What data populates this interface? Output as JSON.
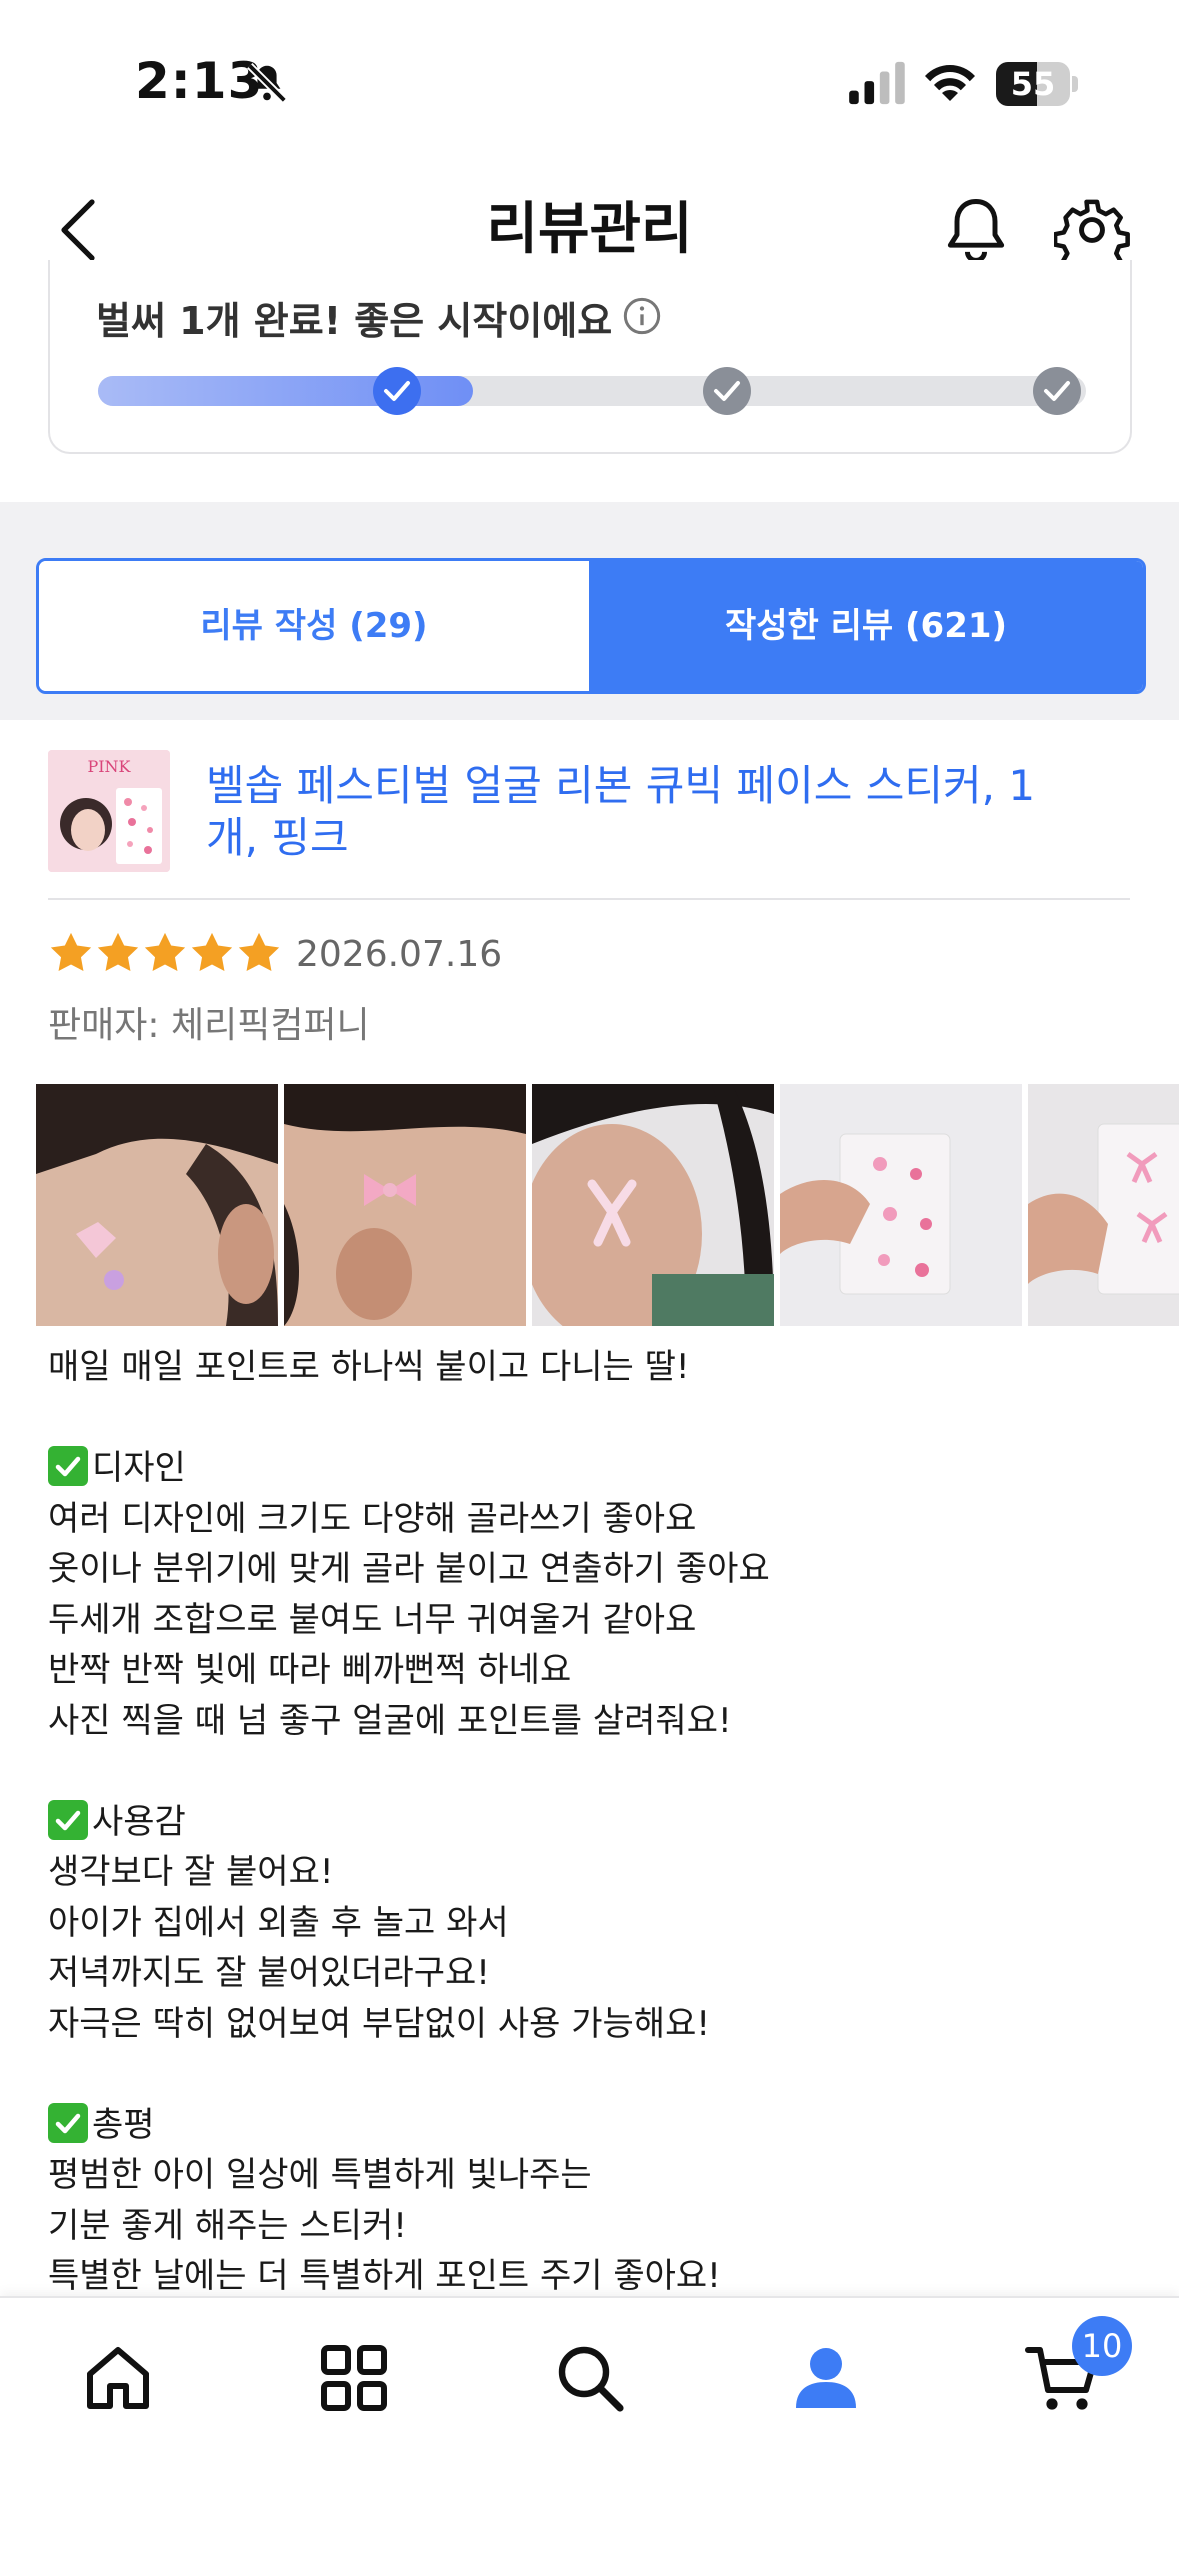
{
  "status_bar": {
    "time": "2:13",
    "battery": "55"
  },
  "header": {
    "title": "리뷰관리"
  },
  "progress": {
    "message": "벌써 1개 완료! 좋은 시작이에요",
    "completed_steps": 1,
    "total_steps": 3,
    "fill_fraction": 0.38,
    "accent_color": "#3d7cf5"
  },
  "tabs": [
    {
      "label": "리뷰 작성 (29)",
      "selected": false
    },
    {
      "label": "작성한 리뷰 (621)",
      "selected": true
    }
  ],
  "review": {
    "product_name": "벨솝 페스티벌 얼굴 리본 큐빅 페이스 스티커, 1개, 핑크",
    "product_thumb_text": "PINK",
    "rating": 5,
    "date": "2026.07.16",
    "seller_label": "판매자:",
    "seller_name": "체리픽컴퍼니",
    "photo_count_visible": 5,
    "lines": [
      {
        "text": "매일 매일 포인트로 하나씩 붙이고 다니는 딸!",
        "check": false
      },
      {
        "text": "",
        "check": false
      },
      {
        "text": "디자인",
        "check": true
      },
      {
        "text": "여러 디자인에 크기도 다양해 골라쓰기 좋아요",
        "check": false
      },
      {
        "text": "옷이나 분위기에 맞게 골라 붙이고 연출하기 좋아요",
        "check": false
      },
      {
        "text": "두세개 조합으로 붙여도 너무 귀여울거 같아요",
        "check": false
      },
      {
        "text": "반짝 반짝 빛에 따라 삐까뻔쩍 하네요",
        "check": false
      },
      {
        "text": "사진 찍을 때 넘 좋구 얼굴에 포인트를 살려줘요!",
        "check": false
      },
      {
        "text": "",
        "check": false
      },
      {
        "text": "사용감",
        "check": true
      },
      {
        "text": "생각보다 잘 붙어요!",
        "check": false
      },
      {
        "text": "아이가 집에서 외출 후 놀고 와서",
        "check": false
      },
      {
        "text": "저녁까지도 잘 붙어있더라구요!",
        "check": false
      },
      {
        "text": "자극은 딱히 없어보여 부담없이 사용 가능해요!",
        "check": false
      },
      {
        "text": "",
        "check": false
      },
      {
        "text": "총평",
        "check": true
      },
      {
        "text": "평범한 아이 일상에 특별하게 빛나주는",
        "check": false
      },
      {
        "text": "기분 좋게 해주는 스티커!",
        "check": false
      },
      {
        "text": "특별한 날에는 더 특별하게 포인트 주기 좋아요!",
        "check": false
      }
    ]
  },
  "bottom_nav": {
    "items": [
      {
        "icon": "home-icon"
      },
      {
        "icon": "grid-icon"
      },
      {
        "icon": "search-icon"
      },
      {
        "icon": "profile-icon",
        "active": true
      },
      {
        "icon": "cart-icon"
      }
    ],
    "cart_badge": "10"
  }
}
